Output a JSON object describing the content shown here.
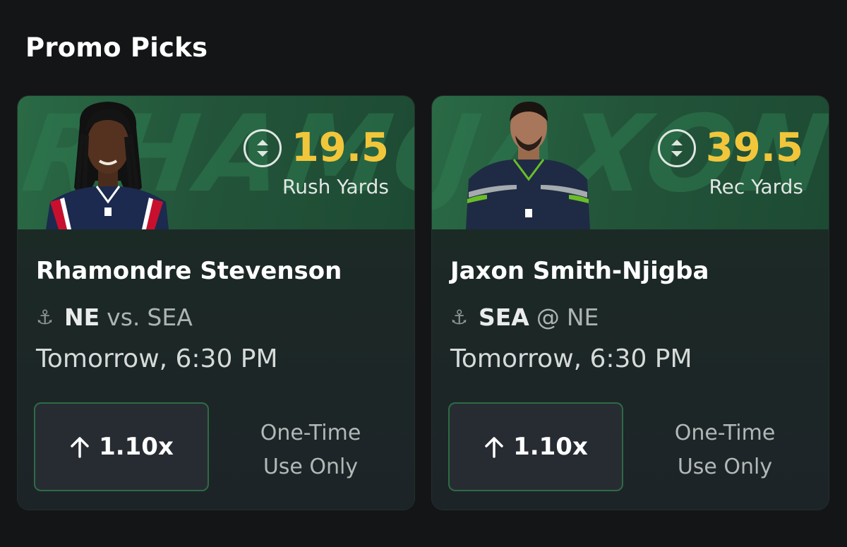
{
  "section": {
    "title": "Promo Picks"
  },
  "picks": [
    {
      "watermark": "RHAMON",
      "line_value": "19.5",
      "stat_label": "Rush Yards",
      "player_name": "Rhamondre Stevenson",
      "team": "NE",
      "separator": "vs.",
      "opponent": "SEA",
      "game_time": "Tomorrow, 6:30 PM",
      "multiplier": "1.10x",
      "usage_line1": "One-Time",
      "usage_line2": "Use Only",
      "jersey_color": "#1b2a4e",
      "accent_color": "#c8102e"
    },
    {
      "watermark": "JAXON",
      "line_value": "39.5",
      "stat_label": "Rec Yards",
      "player_name": "Jaxon Smith-Njigba",
      "team": "SEA",
      "separator": "@",
      "opponent": "NE",
      "game_time": "Tomorrow, 6:30 PM",
      "multiplier": "1.10x",
      "usage_line1": "One-Time",
      "usage_line2": "Use Only",
      "jersey_color": "#1f2b44",
      "accent_color": "#69be28"
    }
  ],
  "colors": {
    "line_value": "#f2c63b",
    "banner": "#2a6a45",
    "button_border": "#2e6b44"
  }
}
